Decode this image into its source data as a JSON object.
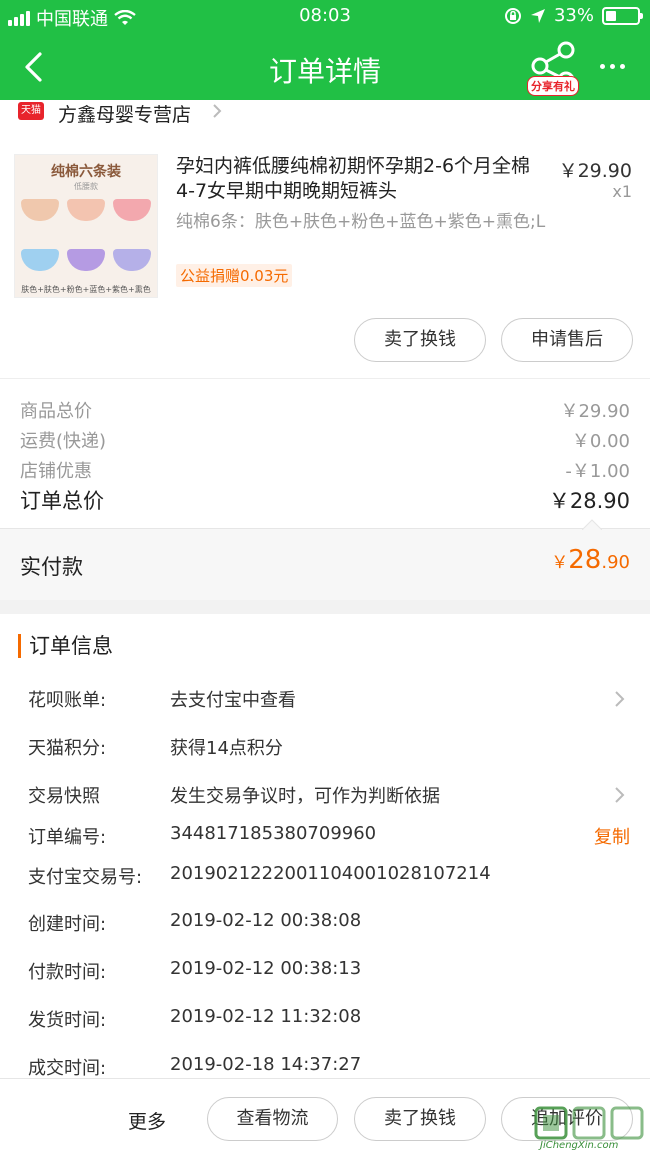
{
  "status_bar": {
    "carrier": "中国联通",
    "time": "08:03",
    "battery": "33%",
    "battery_level": 0.33
  },
  "nav": {
    "title": "订单详情",
    "share_badge": "分享有礼"
  },
  "shop": {
    "tag": "天猫",
    "name": "方鑫母婴专营店"
  },
  "product": {
    "title": "孕妇内裤低腰纯棉初期怀孕期2-6个月全棉4-7女早期中期晚期短裤头",
    "price": "￥29.90",
    "qty": "x1",
    "spec": "纯棉6条：肤色+肤色+粉色+蓝色+紫色+熏色;L",
    "charity": "公益捐赠0.03元",
    "thumb_title": "纯棉六条装",
    "thumb_sub": "低腰款",
    "thumb_caption": "肤色+肤色+粉色+蓝色+紫色+熏色",
    "colors": [
      "#f0c8ad",
      "#f3c4b0",
      "#f3a8ae",
      "#9fd0f0",
      "#b59be3",
      "#b5b0e8"
    ],
    "btn_sell": "卖了换钱",
    "btn_aftersale": "申请售后"
  },
  "summary": {
    "rows": [
      {
        "label": "商品总价",
        "value": "￥29.90"
      },
      {
        "label": "运费(快递)",
        "value": "￥0.00"
      },
      {
        "label": "店铺优惠",
        "value": "-￥1.00"
      }
    ],
    "total_label": "订单总价",
    "total_value": "￥28.90",
    "paid_label": "实付款",
    "paid_currency": "￥",
    "paid_int": "28",
    "paid_dec": ".90"
  },
  "order_info": {
    "heading": "订单信息",
    "rows": [
      {
        "label": "花呗账单:",
        "value": "去支付宝中查看"
      },
      {
        "label": "天猫积分:",
        "value": "获得14点积分"
      },
      {
        "label": "交易快照",
        "value": "发生交易争议时，可作为判断依据"
      },
      {
        "label": "订单编号:",
        "value": "344817185380709960",
        "action": "复制"
      },
      {
        "label": "支付宝交易号:",
        "value": "2019021222001104001028107214"
      },
      {
        "label": "创建时间:",
        "value": "2019-02-12 00:38:08"
      },
      {
        "label": "付款时间:",
        "value": "2019-02-12 00:38:13"
      },
      {
        "label": "发货时间:",
        "value": "2019-02-12 11:32:08"
      },
      {
        "label": "成交时间:",
        "value": "2019-02-18 14:37:27"
      }
    ]
  },
  "bottom_bar": {
    "more": "更多",
    "btn_logistics": "查看物流",
    "btn_sell": "卖了换钱",
    "btn_review": "追加评价"
  },
  "watermark": {
    "text": "JiChengXin.com"
  },
  "colors": {
    "brand_green": "#21c045",
    "accent_orange": "#f56a00",
    "tmall_red": "#e8242c"
  }
}
